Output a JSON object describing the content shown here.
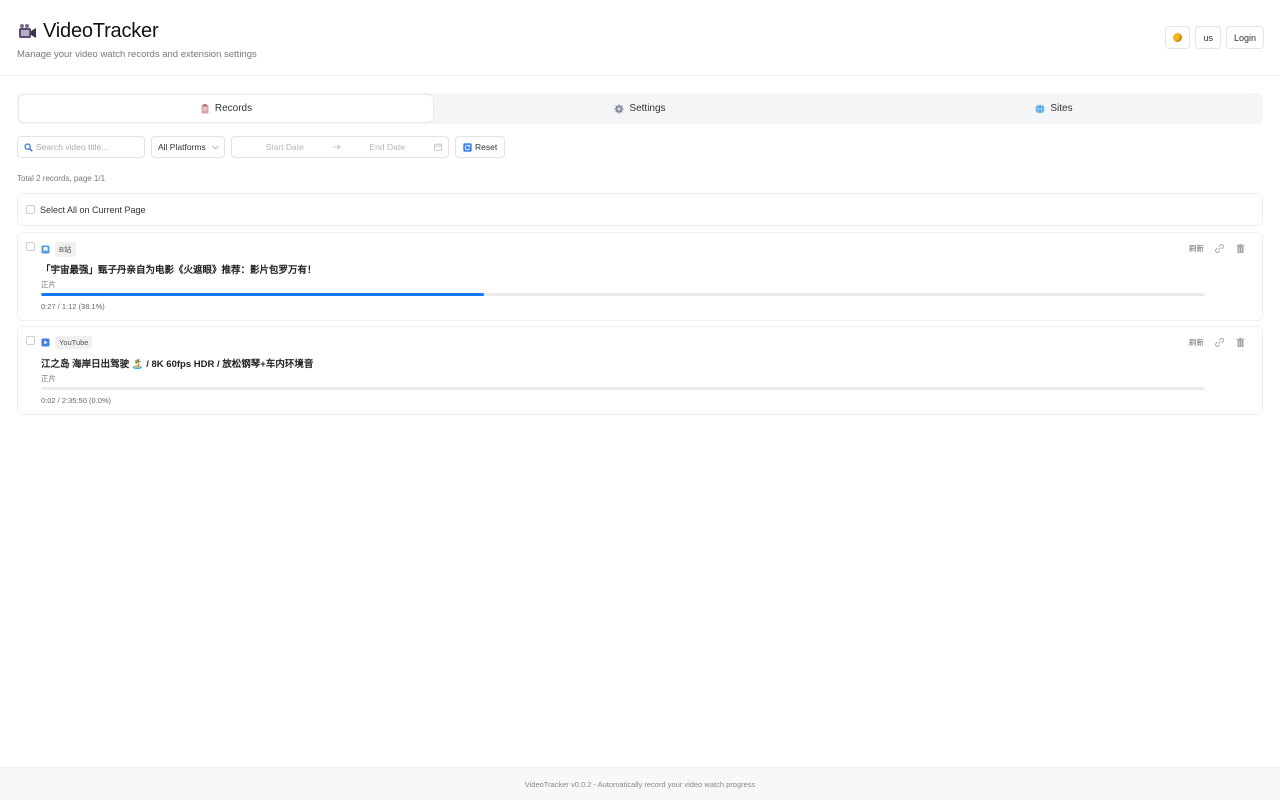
{
  "app": {
    "title": "VideoTracker",
    "subtitle": "Manage your video watch records and extension settings"
  },
  "header": {
    "theme_icon": "moon-icon",
    "lang_label": "us",
    "login_label": "Login"
  },
  "tabs": [
    {
      "label": "Records",
      "icon": "clipboard-icon",
      "active": true
    },
    {
      "label": "Settings",
      "icon": "gear-icon",
      "active": false
    },
    {
      "label": "Sites",
      "icon": "globe-icon",
      "active": false
    }
  ],
  "filters": {
    "search_placeholder": "Search video title...",
    "platform_value": "All Platforms",
    "start_date_placeholder": "Start Date",
    "end_date_placeholder": "End Date",
    "reset_label": "Reset"
  },
  "summary": {
    "total_text": "Total 2 records, page 1/1",
    "select_all_label": "Select All on Current Page"
  },
  "records": [
    {
      "platform": "B站",
      "platform_icon": "bilibili-icon",
      "title": "「宇宙最强」甄子丹亲自为电影《火遮眼》推荐：影片包罗万有！",
      "type": "正片",
      "progress_percent": 38.1,
      "time_text": "0:27 / 1:12 (38.1%)",
      "action_label": "刷新"
    },
    {
      "platform": "YouTube",
      "platform_icon": "youtube-icon",
      "title": "江之岛 海岸日出驾驶 🏝️ / 8K 60fps HDR / 放松钢琴+车内环境音",
      "type": "正片",
      "progress_percent": 0.0,
      "time_text": "0:02 / 2:35:50 (0.0%)",
      "action_label": "刷新"
    }
  ],
  "footer": {
    "text": "VideoTracker v0.0.2 - Automatically record your video watch progress"
  },
  "colors": {
    "accent": "#1677ff",
    "tab_bg": "#f4f5f7"
  }
}
